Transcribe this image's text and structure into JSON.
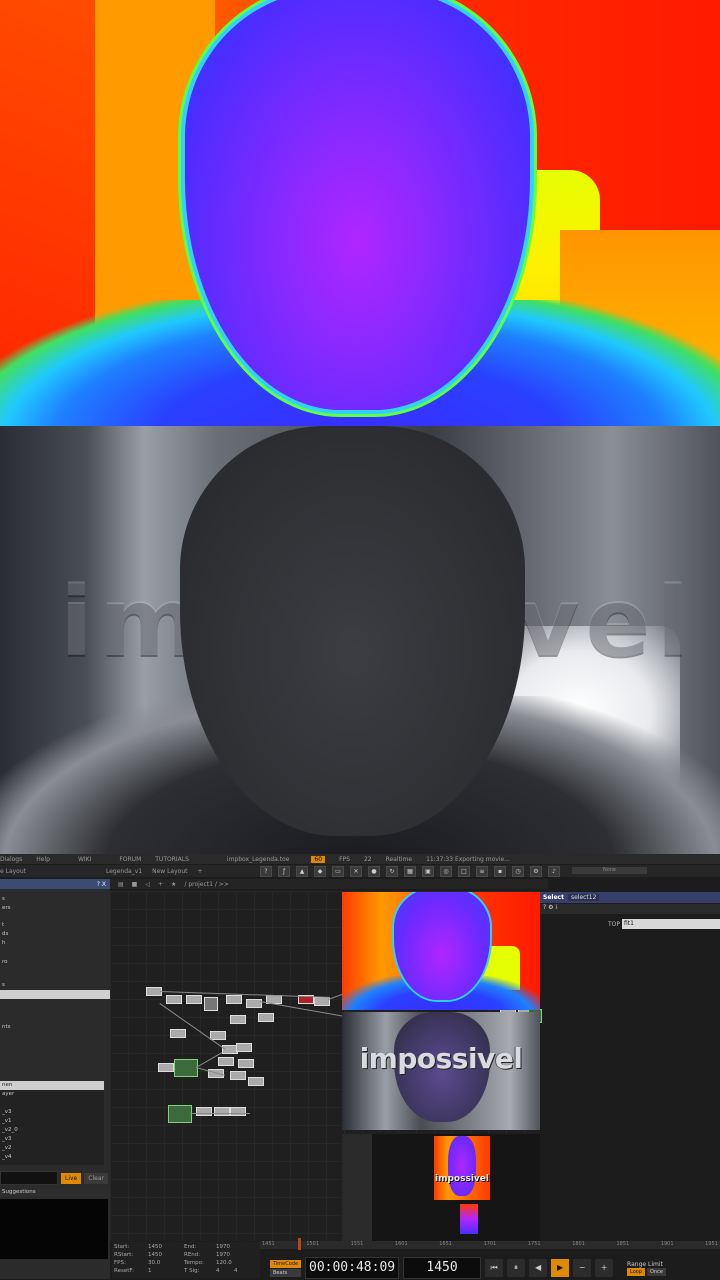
{
  "top_view": {
    "kind": "depth-map"
  },
  "middle_view": {
    "overlay_text": "impossivel"
  },
  "td": {
    "menubar": [
      "Dialogs",
      "Help",
      "WIKI",
      "FORUM",
      "TUTORIALS",
      "impbox_Legenda.toe",
      "FPS",
      "Realtime",
      "11:37:33 Exporting movie..."
    ],
    "menu_fps_box": "60",
    "menu_fps_value": "22",
    "toolbar2": {
      "layout": "e Layout",
      "tab1": "Legenda_v1",
      "tab2": "New Layout",
      "plus": "+",
      "help": "?",
      "slider": "None"
    },
    "toolbar3": {
      "path": "/ project1 / >>"
    },
    "leftpanel": {
      "header": "? X",
      "items": [
        "s",
        "ers",
        "t",
        "ds",
        "h",
        "ro",
        "s",
        "",
        "nts"
      ],
      "list": [
        "nen",
        "ayer",
        "",
        "_v3",
        "_v1",
        "_v2_0",
        "_v3",
        "_v2",
        "_v4"
      ],
      "live": "Live",
      "clear": "Clear",
      "suggestions": "Suggestions"
    },
    "params": {
      "type": "Select",
      "name": "select12",
      "icons": "? ⚙ i",
      "top_label": "TOP",
      "top_value": "fit1"
    },
    "preview_text": "impossivel",
    "preview_mini_text": "impossivel",
    "timeline_ticks": [
      "1451",
      "1501",
      "1551",
      "1601",
      "1651",
      "1701",
      "1751",
      "1801",
      "1851",
      "1901",
      "1951"
    ],
    "info": {
      "start_label": "Start:",
      "start": "1450",
      "end_label": "End:",
      "end": "1970",
      "rstart_label": "RStart:",
      "rstart": "1450",
      "rend_label": "REnd:",
      "rend": "1970",
      "fps_label": "FPS:",
      "fps": "30.0",
      "tempo_label": "Tempo:",
      "tempo": "120.0",
      "resetf_label": "ResetF:",
      "resetf": "1",
      "tsig_label": "T Sig:",
      "tsig_a": "4",
      "tsig_b": "4"
    },
    "transport": {
      "timecode_btn": "TimeCode",
      "beats_btn": "Beats",
      "timecode": "00:00:48:09",
      "frame": "1450",
      "range_limit": "Range Limit",
      "loop": "Loop",
      "once": "Once"
    }
  }
}
